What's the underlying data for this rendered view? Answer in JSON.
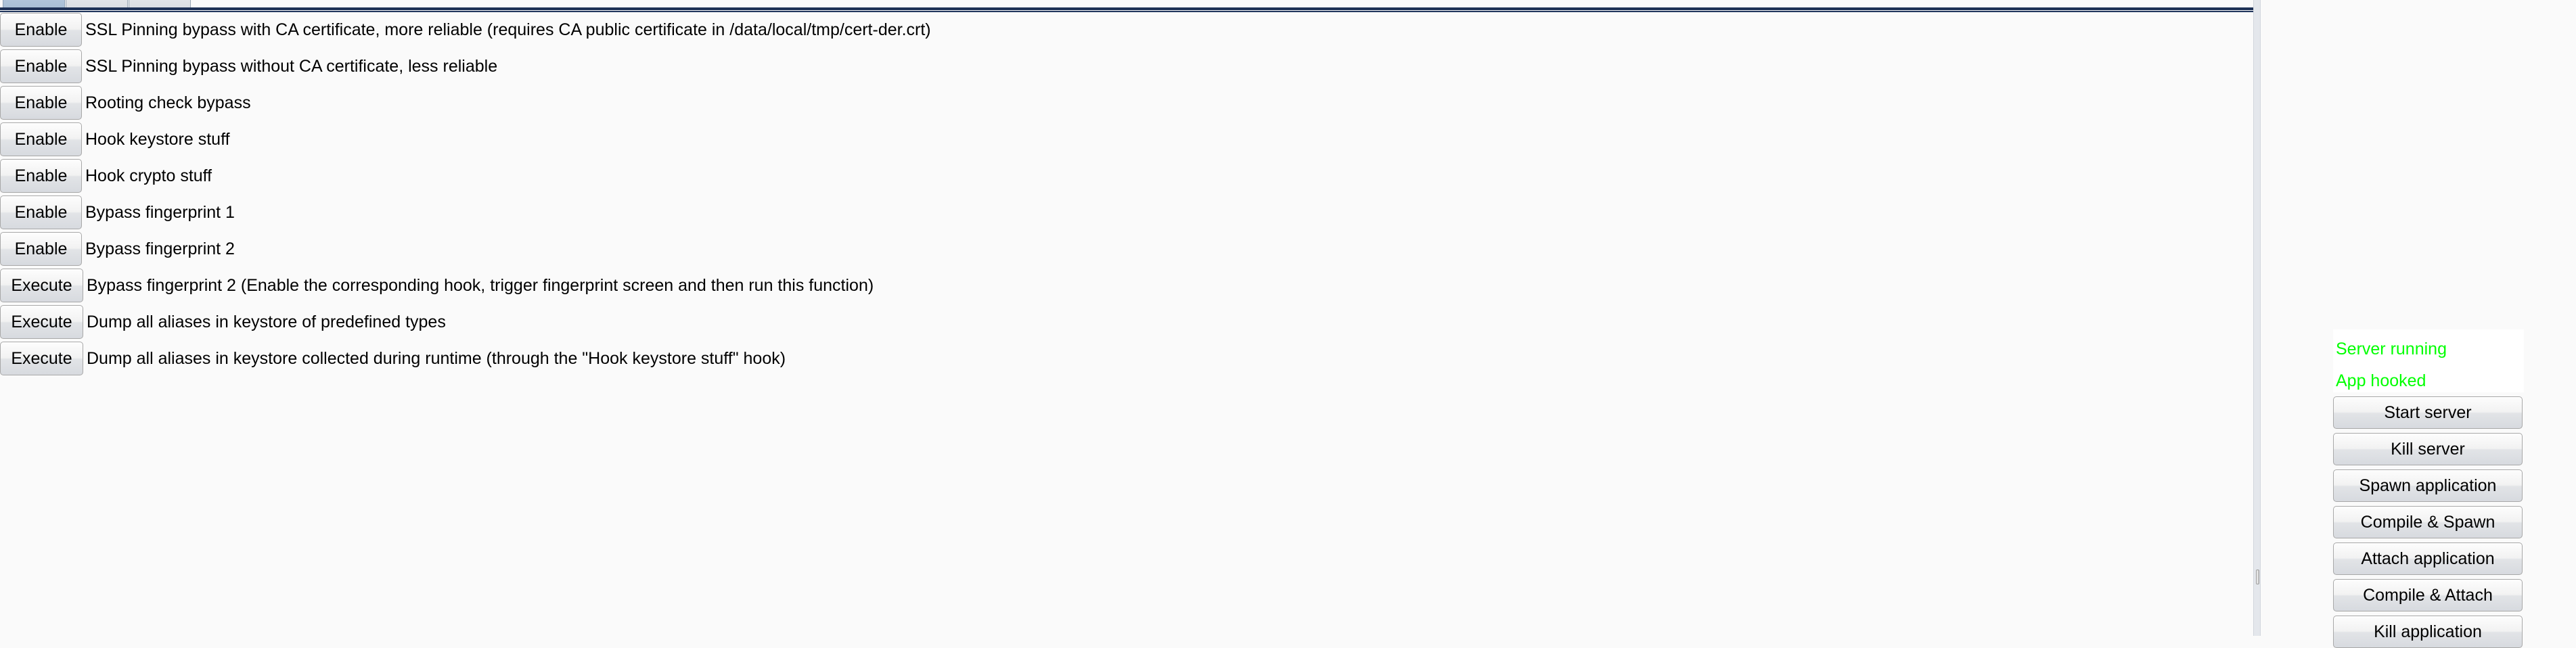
{
  "window": {
    "background_color": "#fafafa"
  },
  "tabs": {
    "items": [
      {
        "label": "",
        "selected": true
      },
      {
        "label": "",
        "selected": false
      },
      {
        "label": "",
        "selected": false
      }
    ],
    "divider_color": "#1d3055"
  },
  "hooks": {
    "rows": [
      {
        "action_label": "Enable",
        "action_type": "enable",
        "description": "SSL Pinning bypass with CA certificate, more reliable (requires CA public certificate in /data/local/tmp/cert-der.crt)"
      },
      {
        "action_label": "Enable",
        "action_type": "enable",
        "description": "SSL Pinning bypass without CA certificate, less reliable"
      },
      {
        "action_label": "Enable",
        "action_type": "enable",
        "description": "Rooting check bypass"
      },
      {
        "action_label": "Enable",
        "action_type": "enable",
        "description": "Hook keystore stuff"
      },
      {
        "action_label": "Enable",
        "action_type": "enable",
        "description": "Hook crypto stuff"
      },
      {
        "action_label": "Enable",
        "action_type": "enable",
        "description": "Bypass fingerprint 1"
      },
      {
        "action_label": "Enable",
        "action_type": "enable",
        "description": "Bypass fingerprint 2"
      },
      {
        "action_label": "Execute",
        "action_type": "execute",
        "description": "Bypass fingerprint 2 (Enable the corresponding hook, trigger fingerprint screen and then run this function)"
      },
      {
        "action_label": "Execute",
        "action_type": "execute",
        "description": "Dump all aliases in keystore of predefined types"
      },
      {
        "action_label": "Execute",
        "action_type": "execute",
        "description": "Dump all aliases in keystore collected during runtime (through the \"Hook keystore stuff\" hook)"
      }
    ]
  },
  "control_panel": {
    "status": {
      "color": "#00ff00",
      "lines": [
        "Server running",
        "App hooked"
      ]
    },
    "buttons": [
      {
        "label": "Start server",
        "name": "start-server-button"
      },
      {
        "label": "Kill server",
        "name": "kill-server-button"
      },
      {
        "label": "Spawn application",
        "name": "spawn-application-button"
      },
      {
        "label": "Compile & Spawn",
        "name": "compile-and-spawn-button"
      },
      {
        "label": "Attach application",
        "name": "attach-application-button"
      },
      {
        "label": "Compile & Attach",
        "name": "compile-and-attach-button"
      },
      {
        "label": "Kill application",
        "name": "kill-application-button"
      }
    ]
  }
}
